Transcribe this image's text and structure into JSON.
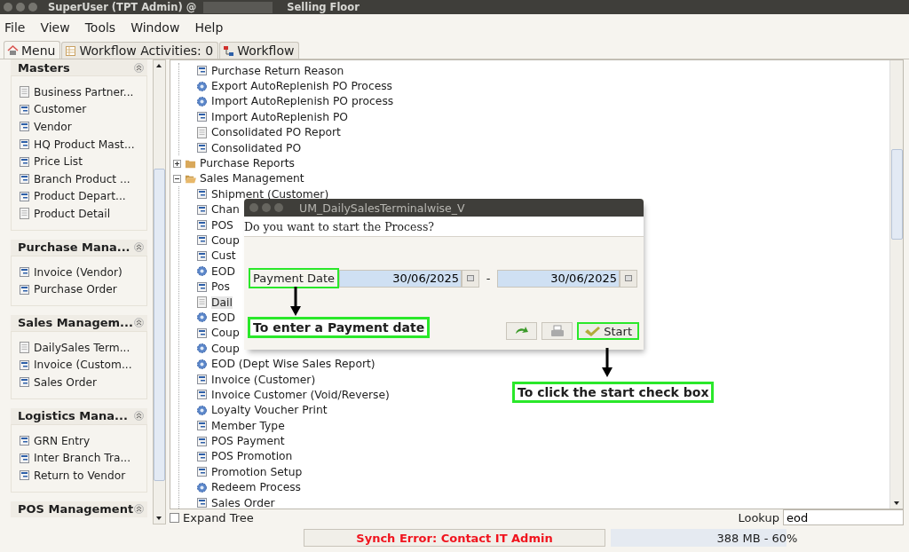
{
  "window": {
    "title_prefix": "SuperUser (TPT Admin) @",
    "title_suffix": "Selling Floor"
  },
  "menu_bar": [
    "File",
    "View",
    "Tools",
    "Window",
    "Help"
  ],
  "tabs": [
    {
      "label": "Menu",
      "selected": true
    },
    {
      "label": "Workflow Activities: 0",
      "selected": false
    },
    {
      "label": "Workflow",
      "selected": false
    }
  ],
  "sidebar": {
    "sections": [
      {
        "title": "Masters",
        "items": [
          {
            "label": "Business Partner...",
            "kind": "report"
          },
          {
            "label": "Customer",
            "kind": "window"
          },
          {
            "label": "Vendor",
            "kind": "window"
          },
          {
            "label": "HQ Product Mast...",
            "kind": "window"
          },
          {
            "label": "Price List",
            "kind": "window"
          },
          {
            "label": "Branch Product ...",
            "kind": "window"
          },
          {
            "label": "Product Depart...",
            "kind": "window"
          },
          {
            "label": "Product Detail",
            "kind": "report"
          }
        ]
      },
      {
        "title": "Purchase Mana...",
        "items": [
          {
            "label": "Invoice (Vendor)",
            "kind": "window"
          },
          {
            "label": "Purchase Order",
            "kind": "window"
          }
        ]
      },
      {
        "title": "Sales Managem...",
        "items": [
          {
            "label": "DailySales Term...",
            "kind": "report"
          },
          {
            "label": "Invoice (Custom...",
            "kind": "window"
          },
          {
            "label": "Sales Order",
            "kind": "window"
          }
        ]
      },
      {
        "title": "Logistics Mana...",
        "items": [
          {
            "label": "GRN Entry",
            "kind": "window"
          },
          {
            "label": "Inter Branch Tra...",
            "kind": "window"
          },
          {
            "label": "Return to Vendor",
            "kind": "window"
          }
        ]
      },
      {
        "title": "POS Management"
      }
    ]
  },
  "tree": [
    {
      "kind": "continued",
      "children": [
        {
          "label": "Purchase Return Reason",
          "kind": "window",
          "selected": false
        },
        {
          "label": "Export AutoReplenish PO Process",
          "kind": "process",
          "selected": false
        },
        {
          "label": "Import AutoReplenish PO process",
          "kind": "process",
          "selected": false
        },
        {
          "label": "Import AutoReplenish PO",
          "kind": "window",
          "selected": false
        },
        {
          "label": "Consolidated PO Report",
          "kind": "report",
          "selected": false
        },
        {
          "label": "Consolidated PO",
          "kind": "window",
          "selected": false
        }
      ]
    },
    {
      "kind": "folder",
      "label": "Purchase Reports",
      "expanded": false
    },
    {
      "kind": "folder",
      "label": "Sales Management",
      "expanded": true,
      "children": [
        {
          "label": "Shipment (Customer)",
          "kind": "window",
          "selected": false
        },
        {
          "label": "Chan",
          "kind": "window",
          "selected": false
        },
        {
          "label": "POS",
          "kind": "window",
          "selected": false
        },
        {
          "label": "Coup",
          "kind": "window",
          "selected": false
        },
        {
          "label": "Cust",
          "kind": "window",
          "selected": false
        },
        {
          "label": "EOD",
          "kind": "process",
          "selected": false
        },
        {
          "label": "Pos",
          "kind": "window",
          "selected": false
        },
        {
          "label": "Dail",
          "kind": "report",
          "selected": true
        },
        {
          "label": "EOD",
          "kind": "process",
          "selected": false
        },
        {
          "label": "Coup",
          "kind": "window",
          "selected": false
        },
        {
          "label": "Coup",
          "kind": "process",
          "selected": false
        },
        {
          "label": "EOD (Dept Wise Sales Report)",
          "kind": "process",
          "selected": false
        },
        {
          "label": "Invoice (Customer)",
          "kind": "window",
          "selected": false
        },
        {
          "label": "Invoice Customer (Void/Reverse)",
          "kind": "window",
          "selected": false
        },
        {
          "label": "Loyalty Voucher Print",
          "kind": "process",
          "selected": false
        },
        {
          "label": "Member Type",
          "kind": "window",
          "selected": false
        },
        {
          "label": "POS Payment",
          "kind": "window",
          "selected": false
        },
        {
          "label": "POS Promotion",
          "kind": "window",
          "selected": false
        },
        {
          "label": "Promotion Setup",
          "kind": "window",
          "selected": false
        },
        {
          "label": "Redeem Process",
          "kind": "process",
          "selected": false
        },
        {
          "label": "Sales Order",
          "kind": "window",
          "selected": false
        }
      ]
    }
  ],
  "expand_tree": {
    "label": "Expand Tree",
    "checked": false
  },
  "lookup": {
    "label": "Lookup",
    "value": "eod"
  },
  "dialog": {
    "title": "UM_DailySalesTerminalwise_V",
    "message": "Do you want to start the Process?",
    "field_label": "Payment Date",
    "field_highlighted": true,
    "date_from": "30/06/2025",
    "separator": "-",
    "date_to": "30/06/2025",
    "start_label": "Start",
    "start_highlighted": true
  },
  "annotations": [
    {
      "text": "To enter a Payment date"
    },
    {
      "text": "To click the start check box"
    }
  ],
  "status_bar": {
    "message": "Synch Error: Contact IT Admin",
    "memory": "388 MB - 60%",
    "level": 0.6
  }
}
